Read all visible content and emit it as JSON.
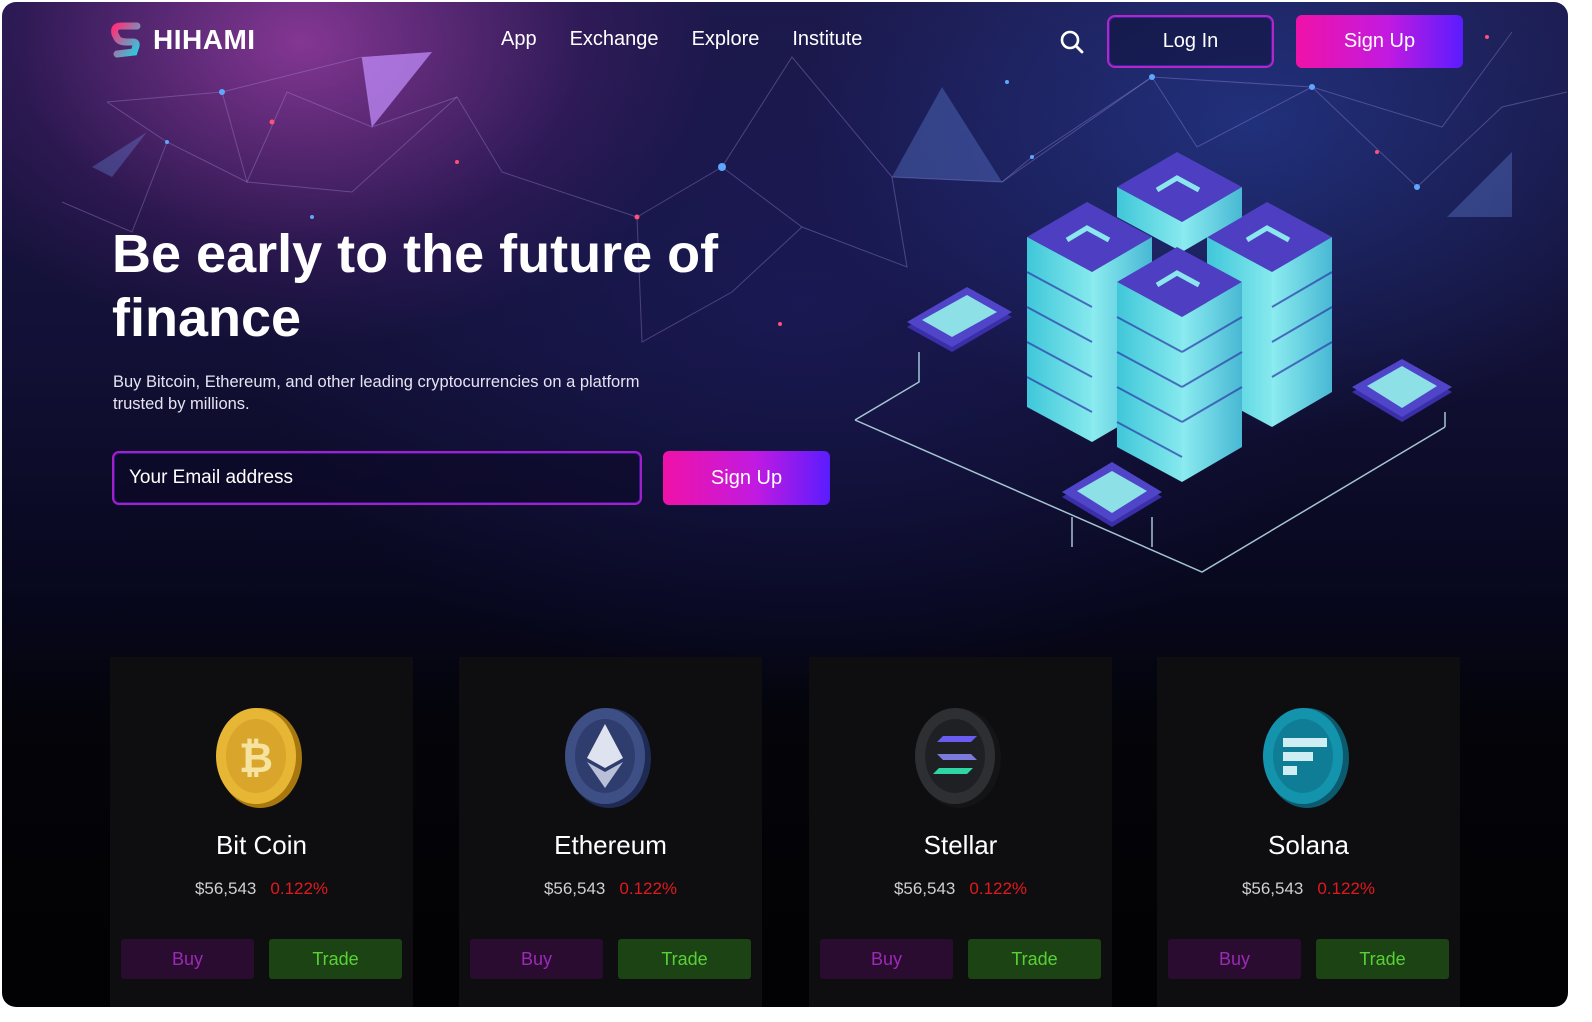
{
  "brand": {
    "name": "HIHAMI",
    "logo_icon": "s-logo-icon"
  },
  "nav": {
    "items": [
      "App",
      "Exchange",
      "Explore",
      "Institute"
    ]
  },
  "header": {
    "search_icon": "search-icon",
    "login_label": "Log In",
    "signup_label": "Sign Up"
  },
  "hero": {
    "title": "Be early to the future of finance",
    "subtitle": "Buy Bitcoin, Ethereum, and other leading cryptocurrencies on a platform trusted by millions.",
    "email_placeholder": "Your Email address",
    "signup_label": "Sign Up",
    "illustration": "server-stack-illustration"
  },
  "colors": {
    "accent_pink": "#f012a8",
    "accent_purple": "#5a1cff",
    "negative": "#e2191c",
    "buy_text": "#9a2ab4",
    "trade_text": "#59d136"
  },
  "cards": [
    {
      "name": "Bit Coin",
      "price": "$56,543",
      "change": "0.122%",
      "buy": "Buy",
      "trade": "Trade",
      "icon": "bitcoin-coin-icon"
    },
    {
      "name": "Ethereum",
      "price": "$56,543",
      "change": "0.122%",
      "buy": "Buy",
      "trade": "Trade",
      "icon": "ethereum-coin-icon"
    },
    {
      "name": "Stellar",
      "price": "$56,543",
      "change": "0.122%",
      "buy": "Buy",
      "trade": "Trade",
      "icon": "stellar-coin-icon"
    },
    {
      "name": "Solana",
      "price": "$56,543",
      "change": "0.122%",
      "buy": "Buy",
      "trade": "Trade",
      "icon": "solana-coin-icon"
    }
  ]
}
